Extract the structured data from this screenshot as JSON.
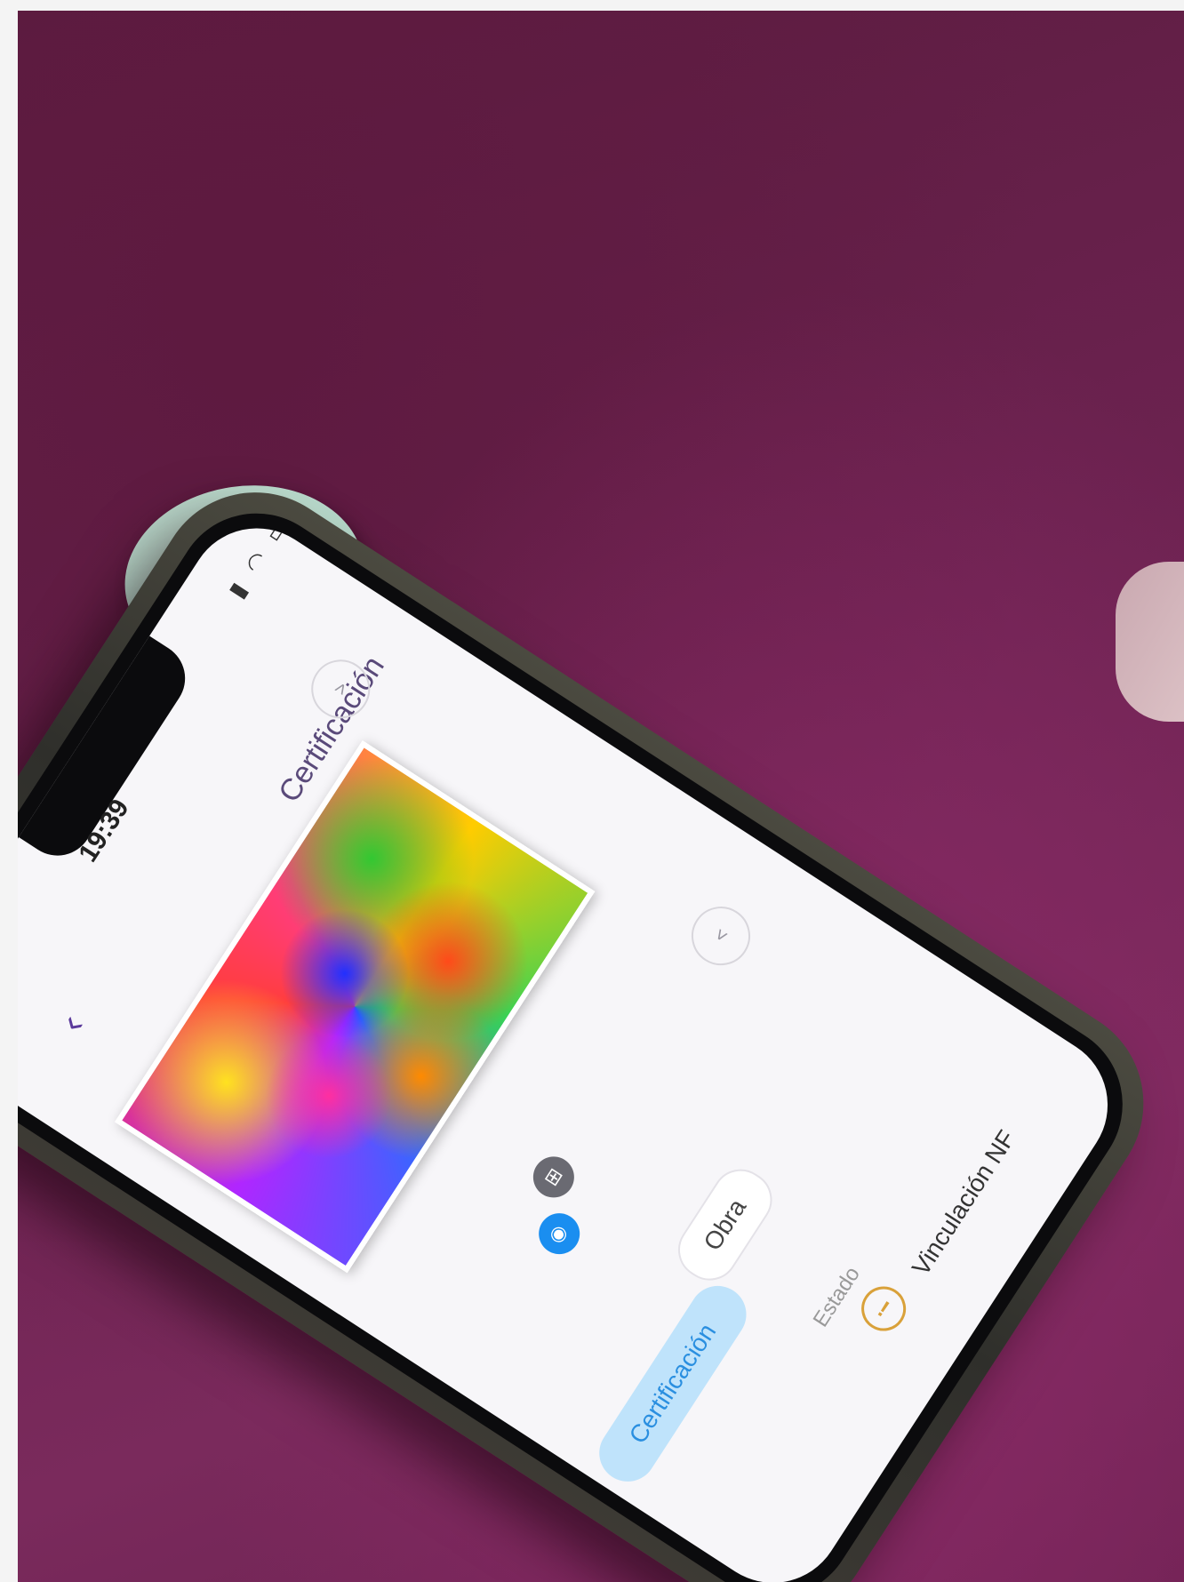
{
  "status_bar": {
    "time": "19:39"
  },
  "header": {
    "title": "Certificación"
  },
  "tabs": [
    {
      "label": "Obra"
    },
    {
      "label": "Certificación"
    }
  ],
  "status": {
    "label": "Estado",
    "value": "Vinculación NF"
  },
  "icons": {
    "back": "chevron-left-icon",
    "prev": "chevron-up-icon",
    "next": "chevron-down-icon",
    "eye": "eye-icon",
    "nfc": "nfc-icon",
    "warning": "warning-icon"
  },
  "colors": {
    "background": "#6a2150",
    "screen": "#f7f6f9",
    "accent": "#2a8fe0",
    "active_tab": "#bfe3fb",
    "warning": "#d9a13a"
  }
}
